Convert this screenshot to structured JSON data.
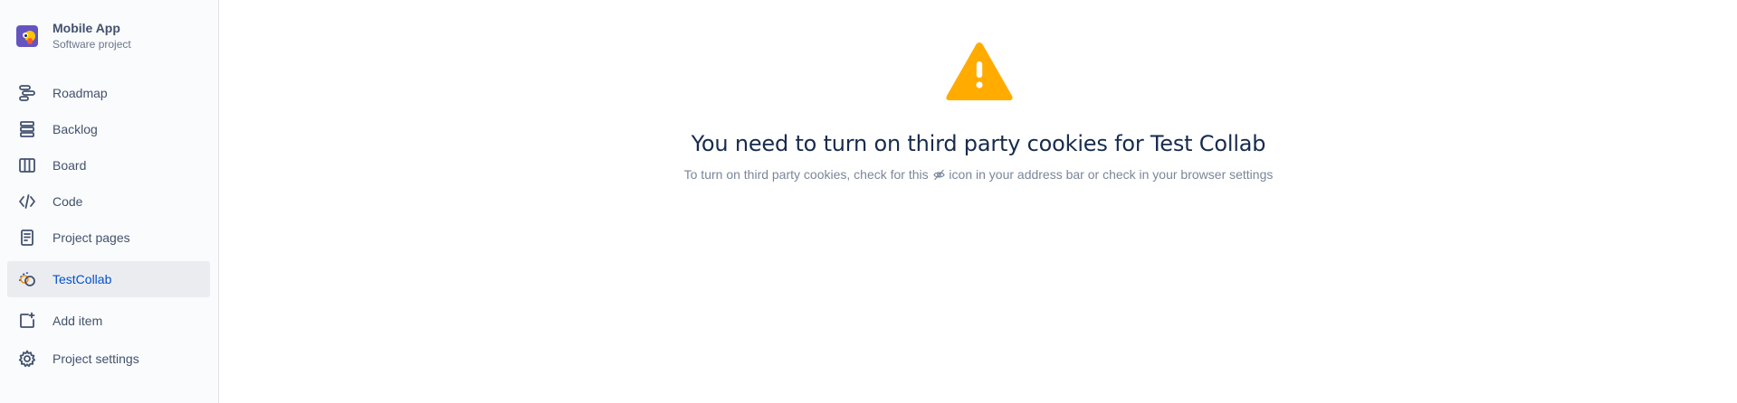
{
  "project": {
    "name": "Mobile App",
    "type": "Software project"
  },
  "sidebar": {
    "items": [
      {
        "label": "Roadmap",
        "icon": "roadmap-icon"
      },
      {
        "label": "Backlog",
        "icon": "backlog-icon"
      },
      {
        "label": "Board",
        "icon": "board-icon"
      },
      {
        "label": "Code",
        "icon": "code-icon"
      },
      {
        "label": "Project pages",
        "icon": "project-pages-icon"
      },
      {
        "label": "TestCollab",
        "icon": "testcollab-icon",
        "active": true
      },
      {
        "label": "Add item",
        "icon": "add-item-icon"
      },
      {
        "label": "Project settings",
        "icon": "gear-icon"
      }
    ]
  },
  "main": {
    "headline": "You need to turn on third party cookies for Test Collab",
    "subtext_before": "To turn on third party cookies, check for this",
    "subtext_after": "icon in your address bar or check in your browser settings",
    "warning_icon": "warning-icon",
    "inline_icon": "eye-slash-icon"
  },
  "colors": {
    "warning": "#ffab00",
    "active_bg": "#ebecf0",
    "active_text": "#0052cc",
    "text": "#42526e"
  }
}
